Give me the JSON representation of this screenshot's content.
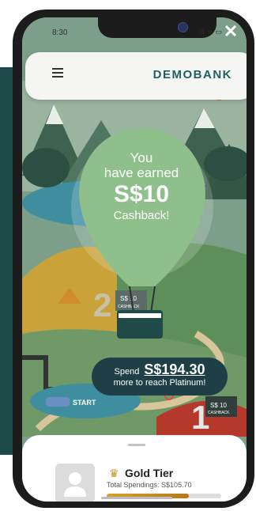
{
  "status_bar": {
    "time": "8:30",
    "icons": "ıl ≈ ▭"
  },
  "close_label": "✕",
  "header": {
    "brand": "DEMOBANK"
  },
  "balloon": {
    "line1": "You",
    "line2": "have earned",
    "amount": "S$10",
    "line3": "Cashback!"
  },
  "map": {
    "start_label": "START",
    "stage2_cashback_amount": "S$ 10",
    "stage2_cashback_label": "CASHBACK",
    "stage1_cashback_amount": "S$ 10",
    "stage1_cashback_label": "CASHBACK",
    "stage2_number": "2",
    "stage1_number": "1"
  },
  "spend": {
    "prefix": "Spend",
    "amount": "S$194.30",
    "suffix": "more to reach Platinum!"
  },
  "tier_card": {
    "tier_name": "Gold Tier",
    "total_label": "Total Spendings: S$105.70",
    "progress_fraction": 0.72
  },
  "colors": {
    "brand": "#1f5f64",
    "gold": "#c99320",
    "pill": "#1d3f45",
    "balloon": "#8fbf8a"
  }
}
